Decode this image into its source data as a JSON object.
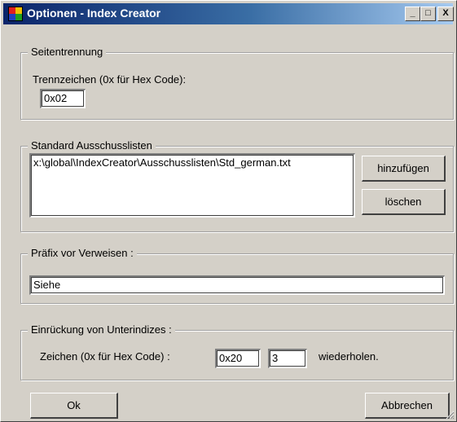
{
  "window": {
    "title": "Optionen - Index Creator",
    "controls": {
      "minimize": "_",
      "maximize": "□",
      "close": "X"
    }
  },
  "page_separation": {
    "legend": "Seitentrennung",
    "separator_label": "Trennzeichen (0x für Hex Code):",
    "separator_value": "0x02"
  },
  "exclusion_lists": {
    "legend": "Standard Ausschusslisten",
    "items": [
      "x:\\global\\IndexCreator\\Ausschusslisten\\Std_german.txt"
    ],
    "add_label": "hinzufügen",
    "delete_label": "löschen"
  },
  "reference_prefix": {
    "legend": "Präfix vor Verweisen :",
    "value": "Siehe"
  },
  "subindex_indent": {
    "legend": "Einrückung von Unterindizes :",
    "chars_label": "Zeichen (0x für Hex Code) :",
    "char_value": "0x20",
    "repeat_value": "3",
    "repeat_label": "wiederholen."
  },
  "footer": {
    "ok_label": "Ok",
    "cancel_label": "Abbrechen"
  }
}
